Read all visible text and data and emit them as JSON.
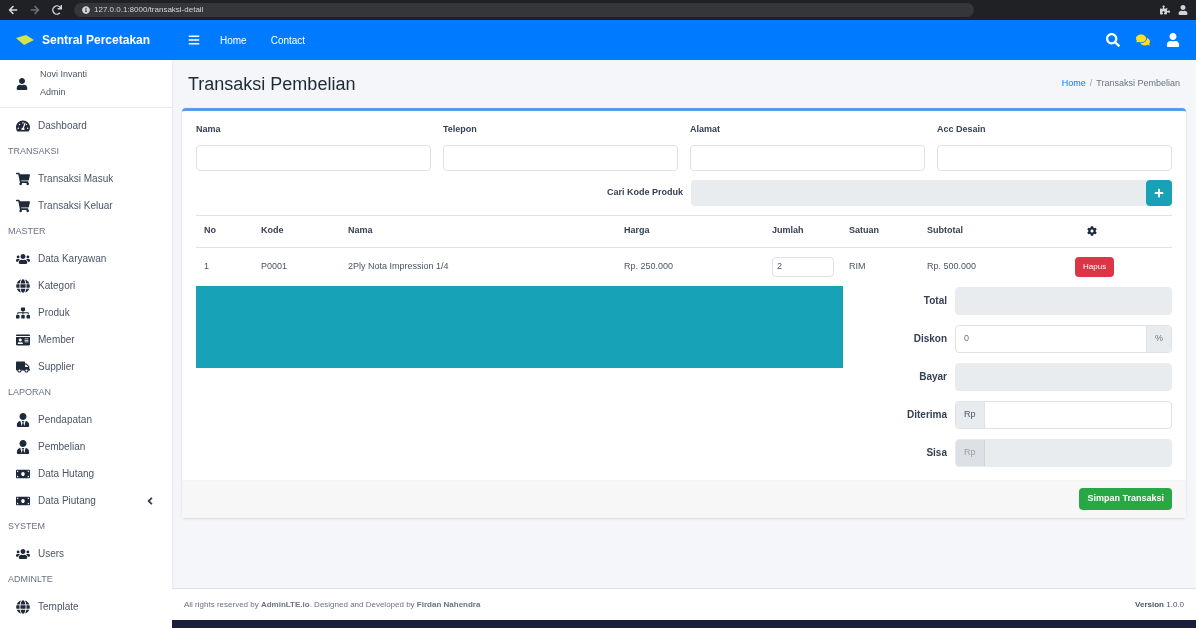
{
  "browser": {
    "url": "127.0.0.1:8000/transaksi-detail"
  },
  "navbar": {
    "brand": "Sentral Percetakan",
    "links": [
      "Home",
      "Contact"
    ]
  },
  "sidebar": {
    "user": {
      "name": "Novi Invanti",
      "role": "Admin"
    },
    "items": [
      {
        "kind": "link",
        "label": "Dashboard",
        "expandable": false
      },
      {
        "kind": "header",
        "label": "TRANSAKSI"
      },
      {
        "kind": "link",
        "label": "Transaksi Masuk",
        "expandable": false
      },
      {
        "kind": "link",
        "label": "Transaksi Keluar",
        "expandable": false
      },
      {
        "kind": "header",
        "label": "MASTER"
      },
      {
        "kind": "link",
        "label": "Data Karyawan",
        "expandable": false
      },
      {
        "kind": "link",
        "label": "Kategori",
        "expandable": false
      },
      {
        "kind": "link",
        "label": "Produk",
        "expandable": false
      },
      {
        "kind": "link",
        "label": "Member",
        "expandable": false
      },
      {
        "kind": "link",
        "label": "Supplier",
        "expandable": false
      },
      {
        "kind": "header",
        "label": "LAPORAN"
      },
      {
        "kind": "link",
        "label": "Pendapatan",
        "expandable": false
      },
      {
        "kind": "link",
        "label": "Pembelian",
        "expandable": false
      },
      {
        "kind": "link",
        "label": "Data Hutang",
        "expandable": false
      },
      {
        "kind": "link",
        "label": "Data Piutang",
        "expandable": true
      },
      {
        "kind": "header",
        "label": "SYSTEM"
      },
      {
        "kind": "link",
        "label": "Users",
        "expandable": false
      },
      {
        "kind": "header",
        "label": "ADMINLTE"
      },
      {
        "kind": "link",
        "label": "Template",
        "expandable": false
      }
    ]
  },
  "page": {
    "title": "Transaksi Pembelian",
    "breadcrumb": [
      "Home",
      "Transaksi Pembelian"
    ],
    "breadcrumb_separator": "/",
    "fields": [
      {
        "label": "Nama"
      },
      {
        "label": "Telepon"
      },
      {
        "label": "Alamat"
      },
      {
        "label": "Acc Desain"
      }
    ],
    "search": {
      "label": "Cari Kode Produk"
    },
    "table": {
      "columns": [
        "No",
        "Kode",
        "Nama",
        "Harga",
        "Jumlah",
        "Satuan",
        "Subtotal"
      ],
      "rows": [
        {
          "no": "1",
          "kode": "P0001",
          "nama": "2Ply Nota Impression 1/4",
          "harga": "Rp. 250.000",
          "jumlah": "2",
          "satuan": "RIM",
          "subtotal": "Rp. 500.000",
          "action": "Hapus"
        }
      ]
    },
    "summary": [
      {
        "label": "Total",
        "disabled": true
      },
      {
        "label": "Diskon",
        "value": "0",
        "suffix": "%",
        "disabled": false
      },
      {
        "label": "Bayar",
        "disabled": true
      },
      {
        "label": "Diterima",
        "prefix": "Rp",
        "disabled": false
      },
      {
        "label": "Sisa",
        "prefix": "Rp",
        "disabled": true
      }
    ],
    "save_button": "Simpan Transaksi"
  },
  "footer": {
    "text": "All rights reserved by **AdminLTE.io**. Designed and Developed by **Firdan Nahendra**",
    "version": "**Version** 1.0.0"
  }
}
